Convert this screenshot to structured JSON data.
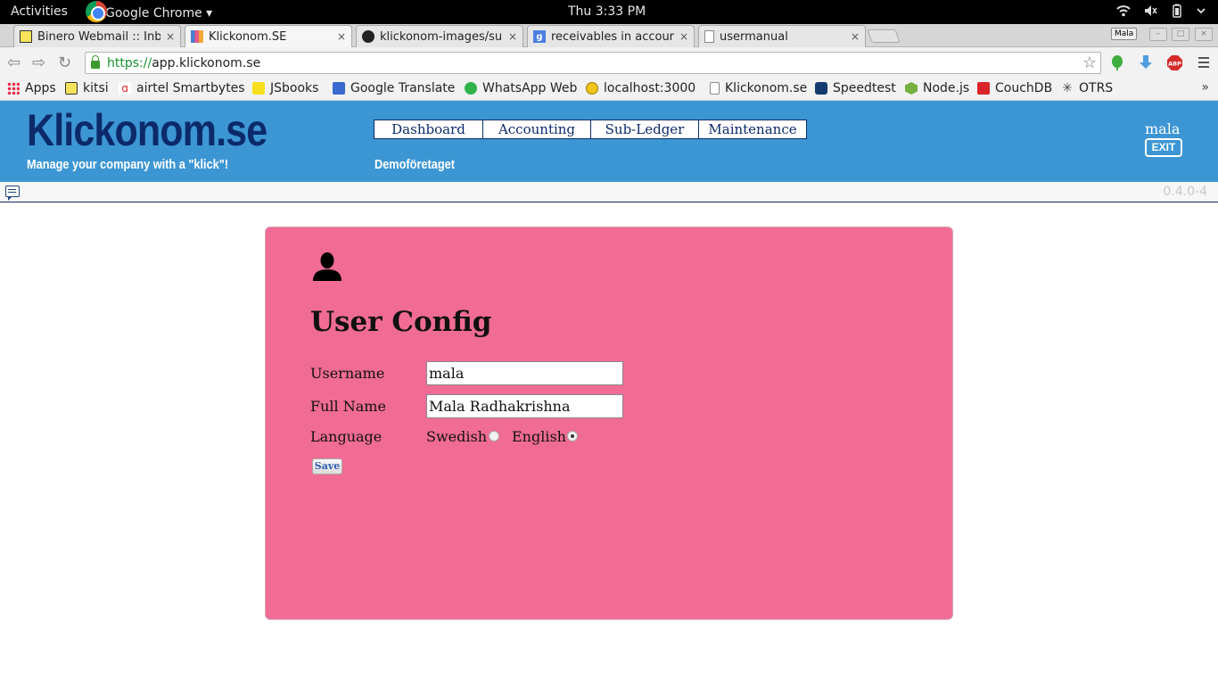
{
  "system_bar": {
    "activities": "Activities",
    "app_name": "Google Chrome ▾",
    "clock": "Thu  3:33 PM"
  },
  "browser": {
    "tabs": [
      {
        "title": "Binero Webmail :: Inb",
        "close": "×"
      },
      {
        "title": "Klickonom.SE",
        "close": "×"
      },
      {
        "title": "klickonom-images/su",
        "close": "×"
      },
      {
        "title": "receivables in accour",
        "close": "×"
      },
      {
        "title": "usermanual",
        "close": "×"
      }
    ],
    "profile": "Mala",
    "url": {
      "scheme": "https://",
      "host": "app.klickonom.se"
    },
    "bookmarks": [
      {
        "label": "Apps"
      },
      {
        "label": "kitsi"
      },
      {
        "label": "airtel Smartbytes"
      },
      {
        "label": "JSbooks"
      },
      {
        "label": "Google Translate"
      },
      {
        "label": "WhatsApp Web"
      },
      {
        "label": "localhost:3000"
      },
      {
        "label": "Klickonom.se"
      },
      {
        "label": "Speedtest"
      },
      {
        "label": "Node.js"
      },
      {
        "label": "CouchDB"
      },
      {
        "label": "OTRS"
      }
    ],
    "bookmarks_more": "»"
  },
  "app": {
    "logo": "Klickonom.se",
    "tagline": "Manage your company with a \"klick\"!",
    "nav": [
      "Dashboard",
      "Accounting",
      "Sub-Ledger",
      "Maintenance"
    ],
    "company": "Demoföretaget",
    "user": "mala",
    "exit": "EXIT",
    "version": "0.4.0-4"
  },
  "form": {
    "title": "User Config",
    "username_label": "Username",
    "username_value": "mala",
    "fullname_label": "Full Name",
    "fullname_value": "Mala Radhakrishna",
    "language_label": "Language",
    "language_options": [
      "Swedish",
      "English"
    ],
    "language_selected": "English",
    "save": "Save"
  },
  "colors": {
    "header_bg": "#3d96d4",
    "logo": "#0c2a6a",
    "panel_bg": "#f06c94"
  }
}
